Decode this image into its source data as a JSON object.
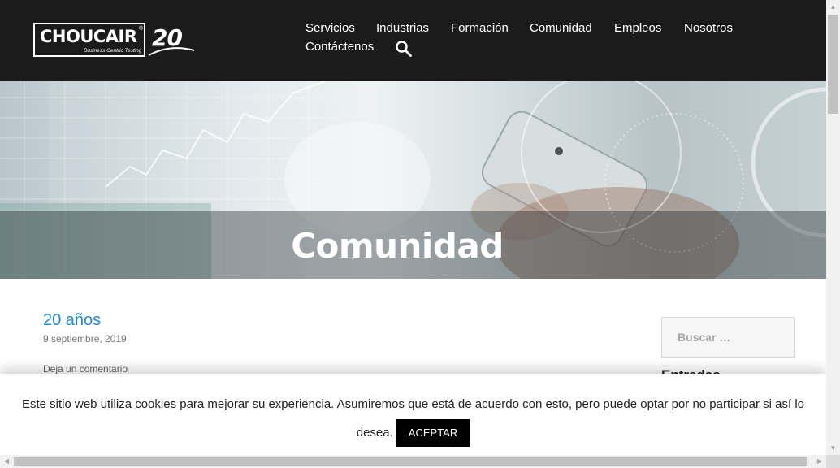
{
  "logo": {
    "brand": "CHOUCAIR",
    "registered": "®",
    "tagline": "Business Centric Testing",
    "anniversary": "20"
  },
  "nav": {
    "items": [
      {
        "label": "Servicios"
      },
      {
        "label": "Industrias"
      },
      {
        "label": "Formación"
      },
      {
        "label": "Comunidad"
      },
      {
        "label": "Empleos"
      },
      {
        "label": "Nosotros"
      },
      {
        "label": "Contáctenos"
      }
    ],
    "search_icon": "search-icon"
  },
  "hero": {
    "title": "Comunidad"
  },
  "post": {
    "title": "20 años",
    "date": "9 septiembre, 2019",
    "comment_link": "Deja un comentario"
  },
  "sidebar": {
    "search_placeholder": "Buscar …",
    "widget_title": "Entradas"
  },
  "cookie": {
    "message": "Este sitio web utiliza cookies para mejorar su experiencia. Asumiremos que está de acuerdo con esto, pero puede optar por no participar si así lo desea.",
    "accept_label": "ACEPTAR"
  },
  "colors": {
    "header_bg": "#1b1b1b",
    "link": "#1e8ad6",
    "button_bg": "#000000"
  }
}
